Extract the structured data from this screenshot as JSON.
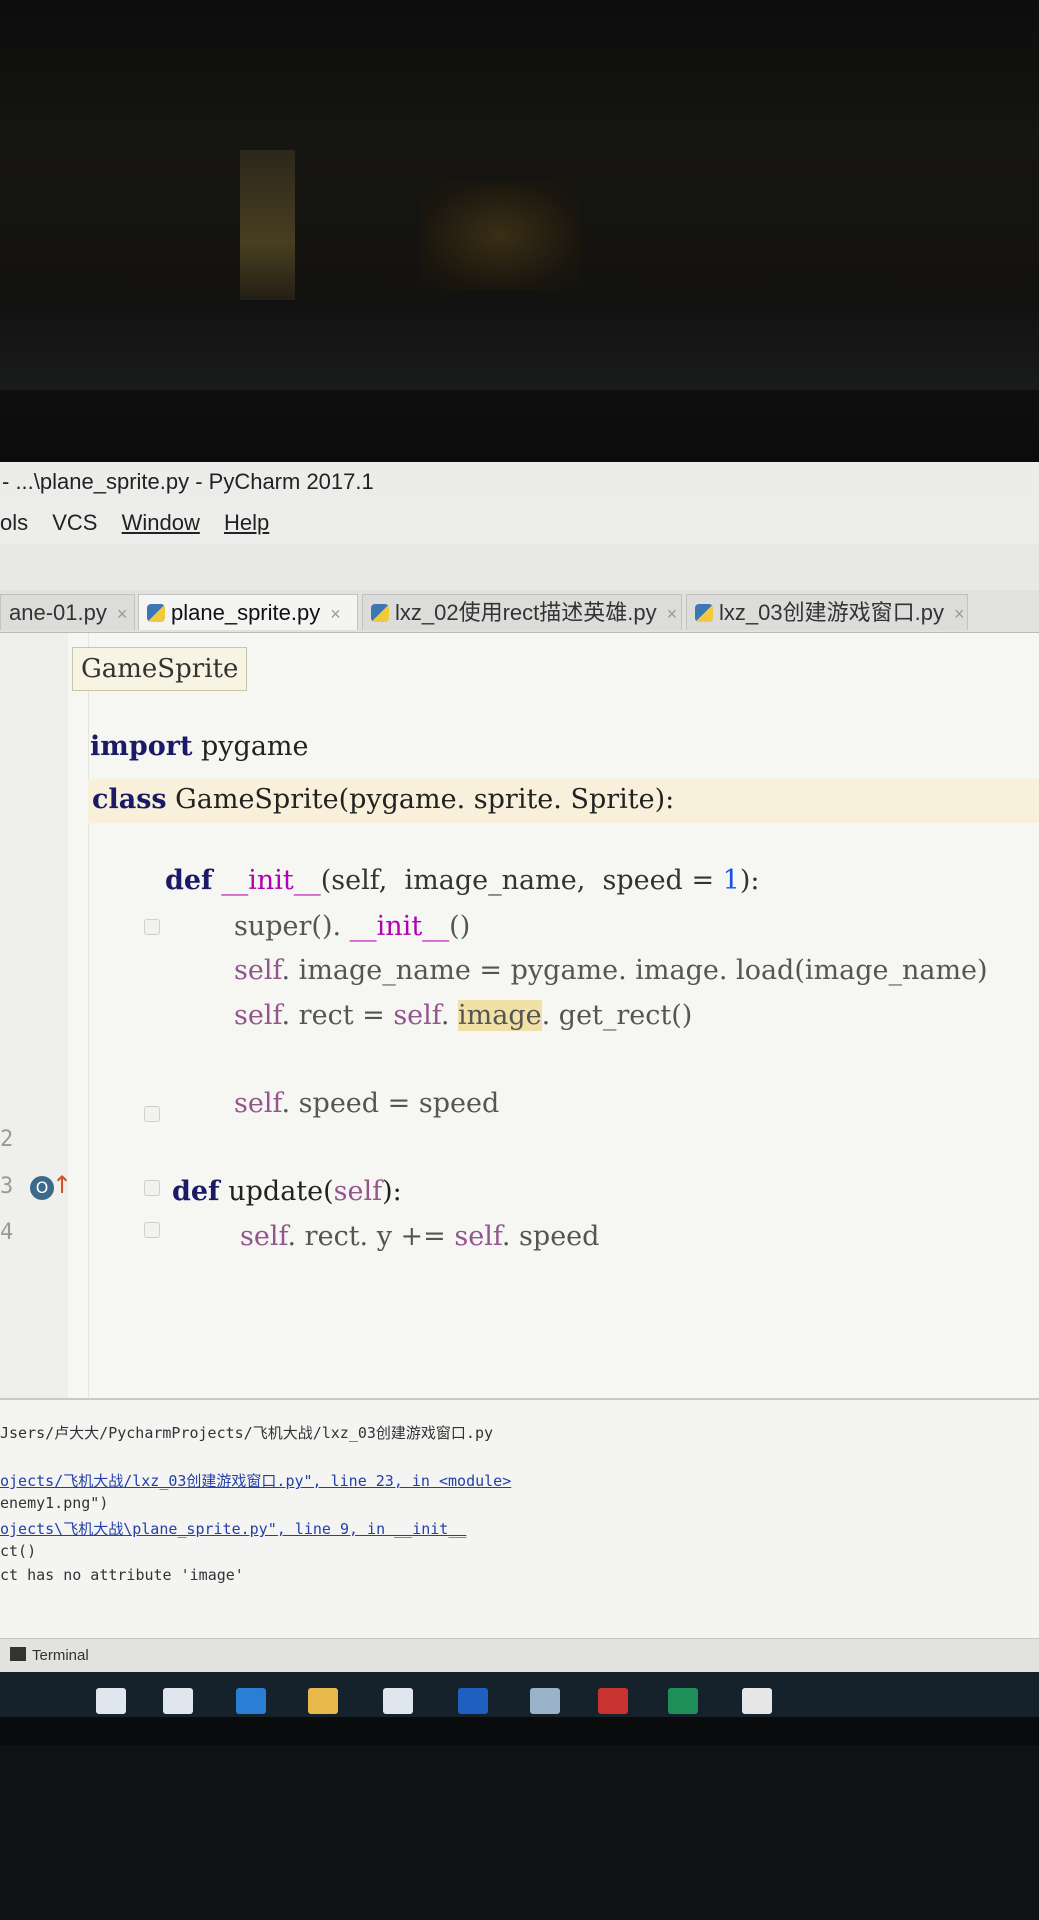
{
  "window": {
    "title": "- ...\\plane_sprite.py - PyCharm 2017.1"
  },
  "menu": [
    "ols",
    "VCS",
    "Window",
    "Help"
  ],
  "tabs": [
    {
      "label": "ane-01.py",
      "active": false
    },
    {
      "label": "plane_sprite.py",
      "active": true
    },
    {
      "label": "lxz_02使用rect描述英雄.py",
      "active": false
    },
    {
      "label": "lxz_03创建游戏窗口.py",
      "active": false
    }
  ],
  "tab_close": "×",
  "breadcrumb": "GameSprite",
  "code": {
    "line_import_kw": "import",
    "line_import_mod": " pygame",
    "line_class_kw": "class",
    "line_class_rest": " GameSprite(pygame. sprite. Sprite):",
    "line_def_init_kw": "def",
    "line_def_init_name": " __init__",
    "line_def_init_args_a": "(self,  image_name,  speed ",
    "line_def_init_eq": "= ",
    "line_def_init_num": "1",
    "line_def_init_end": "):",
    "line_super_a": "super(). ",
    "line_super_b": "__init__",
    "line_super_c": "()",
    "line_load_self": "self",
    "line_load_rest": ". image_name = pygame. image. load(image_name)",
    "line_rect_self": "self",
    "line_rect_mid": ". rect = ",
    "line_rect_self2": "self",
    "line_rect_dot": ". ",
    "line_rect_image": "image",
    "line_rect_end": ". get_rect()",
    "line_speed_self": "self",
    "line_speed_rest": ". speed = speed",
    "line_def_update_kw": "def",
    "line_def_update_rest": " update(",
    "line_def_update_self": "self",
    "line_def_update_end": "):",
    "line_upd_self": "self",
    "line_upd_mid": ". rect. y += ",
    "line_upd_self2": "self",
    "line_upd_end": ". speed"
  },
  "gutter": {
    "n1": "2",
    "n2": "3",
    "n3": "4",
    "override_icon": "O",
    "override_arrow": "↑"
  },
  "run_output": [
    "Jsers/卢大大/PycharmProjects/飞机大战/lxz_03创建游戏窗口.py",
    "",
    "ojects/飞机大战/lxz_03创建游戏窗口.py\", line 23, in <module>",
    "enemy1.png\")",
    "ojects\\飞机大战\\plane_sprite.py\", line 9, in __init__",
    "ct()",
    "ct has no attribute 'image'"
  ],
  "bottombar": {
    "terminal_label": "Terminal"
  },
  "taskbar": [
    {
      "icon": "microphone-icon",
      "color": "#dfe6ee"
    },
    {
      "icon": "task-view-icon",
      "color": "#dfe6ee"
    },
    {
      "icon": "edge-browser-icon",
      "color": "#2a7fd4"
    },
    {
      "icon": "file-explorer-icon",
      "color": "#e8b84a"
    },
    {
      "icon": "store-icon",
      "color": "#dfe6ee"
    },
    {
      "icon": "app-blue-icon",
      "color": "#1f5fbf"
    },
    {
      "icon": "paint-icon",
      "color": "#9ab3c8"
    },
    {
      "icon": "app-red-icon",
      "color": "#c8322f"
    },
    {
      "icon": "pycharm-icon",
      "color": "#1f8f5a"
    },
    {
      "icon": "photos-icon",
      "color": "#e6e6e6"
    }
  ]
}
